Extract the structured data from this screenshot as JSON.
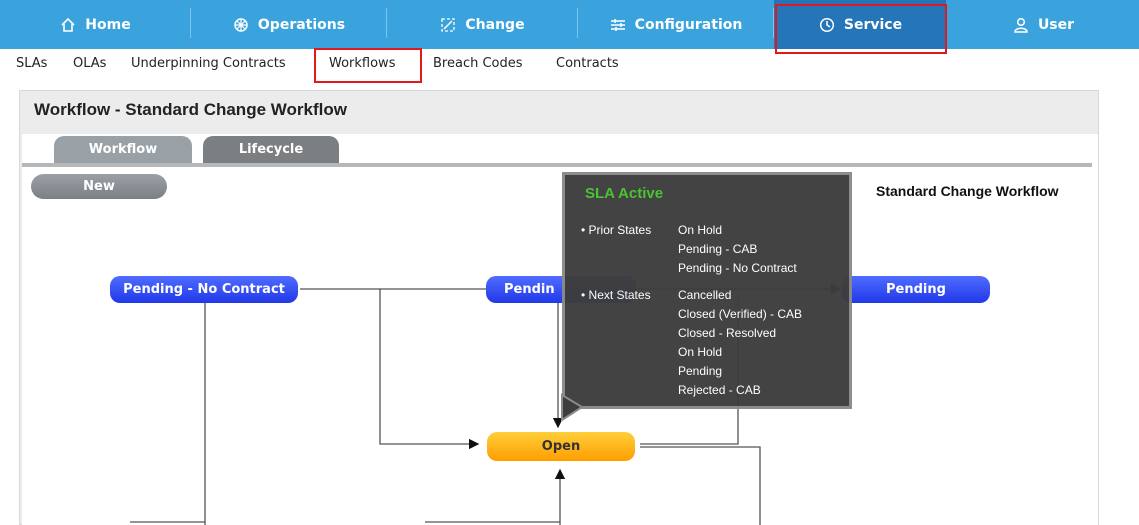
{
  "topnav": {
    "items": [
      {
        "label": "Home",
        "icon": "home-icon"
      },
      {
        "label": "Operations",
        "icon": "operations-icon"
      },
      {
        "label": "Change",
        "icon": "change-icon"
      },
      {
        "label": "Configuration",
        "icon": "configuration-icon"
      },
      {
        "label": "Service",
        "icon": "clock-icon"
      },
      {
        "label": "User",
        "icon": "user-icon"
      }
    ]
  },
  "subnav": {
    "items": [
      "SLAs",
      "OLAs",
      "Underpinning Contracts",
      "Workflows",
      "Breach Codes",
      "Contracts"
    ]
  },
  "panel": {
    "title": "Workflow - Standard Change Workflow",
    "tabs": [
      "Workflow",
      "Lifecycle"
    ]
  },
  "diagram": {
    "name": "Standard Change Workflow",
    "states": {
      "new": "New",
      "pending_no_contract": "Pending - No Contract",
      "pending_cab": "Pendin",
      "pending": "Pending",
      "open": "Open"
    }
  },
  "tooltip": {
    "title": "SLA Active",
    "prior_label": "• Prior States",
    "prior_states": [
      "On Hold",
      "Pending - CAB",
      "Pending - No Contract"
    ],
    "next_label": "• Next States",
    "next_states": [
      "Cancelled",
      "Closed (Verified) - CAB",
      "Closed - Resolved",
      "On Hold",
      "Pending",
      "Rejected - CAB"
    ]
  },
  "colors": {
    "nav_bg": "#3aa3dd",
    "nav_active": "#2576b8",
    "highlight": "#e0191d",
    "sla_active": "#44c42c"
  }
}
